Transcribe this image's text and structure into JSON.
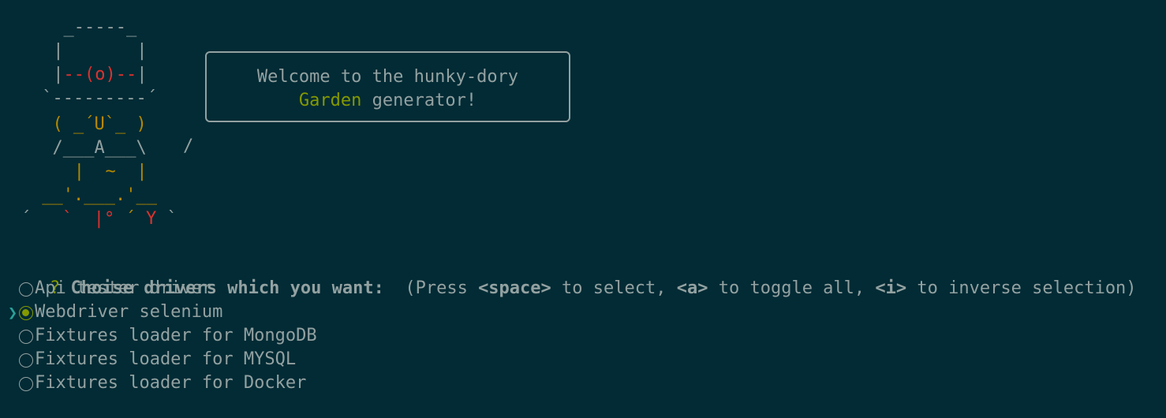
{
  "art": {
    "line1": "  _-----_",
    "line2": " |       |",
    "line3_pipe_l": " |",
    "line3_eye": "--(o)--",
    "line3_pipe_r": "|",
    "line4": " `---------´",
    "line5": "  ( _´U`_ )",
    "line6": "  /___A___\\",
    "line7": "   |  ~  |",
    "line8": " __'.___.'__",
    "line9a": "´   ",
    "line9b": "`  ",
    "line9c": "|° ",
    "line9d": "´ ",
    "line9e": "Y",
    "line9f": " `"
  },
  "bubble": {
    "line1": "Welcome to the hunky-dory",
    "line2_highlight": "Garden",
    "line2_rest": " generator!"
  },
  "prompt": {
    "marker": "?",
    "question": "Choise drivers which you want:",
    "hint_open": "(Press ",
    "key_space": "<space>",
    "hint_mid1": " to select, ",
    "key_a": "<a>",
    "hint_mid2": " to toggle all, ",
    "key_i": "<i>",
    "hint_end": " to inverse selection)"
  },
  "options": [
    {
      "label": "Api tester driver",
      "checked": false,
      "active": false
    },
    {
      "label": "Webdriver selenium",
      "checked": true,
      "active": true
    },
    {
      "label": "Fixtures loader for MongoDB",
      "checked": false,
      "active": false
    },
    {
      "label": "Fixtures loader for MYSQL",
      "checked": false,
      "active": false
    },
    {
      "label": "Fixtures loader for Docker",
      "checked": false,
      "active": false
    }
  ],
  "pointer_glyph": "❯",
  "colors": {
    "background": "#022b35",
    "text": "#93a1a1",
    "accent_green": "#859900",
    "accent_cyan": "#2aa198",
    "red": "#dc322f",
    "yellow": "#b58900"
  }
}
